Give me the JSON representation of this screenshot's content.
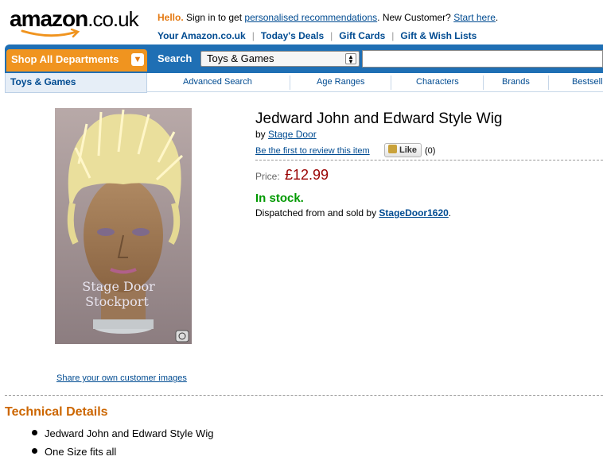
{
  "header": {
    "logo_text": "amazon",
    "logo_suffix": ".co.uk",
    "hello": "Hello.",
    "signin_text": " Sign in to get ",
    "personalised_link": "personalised recommendations",
    "new_customer": ". New Customer? ",
    "start_here": "Start here",
    "period": ".",
    "links": [
      "Your Amazon.co.uk",
      "Today's Deals",
      "Gift Cards",
      "Gift & Wish Lists"
    ]
  },
  "nav": {
    "shop_all": "Shop All Departments",
    "search_label": "Search",
    "search_category": "Toys & Games",
    "search_value": "",
    "store_name": "Toys & Games",
    "sub_items": [
      "Advanced Search",
      "Age Ranges",
      "Characters",
      "Brands",
      "Bestsell"
    ]
  },
  "product": {
    "image_watermark_line1": "Stage Door",
    "image_watermark_line2": "Stockport",
    "share_images": "Share your own customer images",
    "title": "Jedward John and Edward Style Wig",
    "by": "by ",
    "brand": "Stage Door",
    "review_link": "Be the first to review this item",
    "like_label": "Like",
    "like_count": "(0)",
    "price_label": "Price:",
    "price": "£12.99",
    "stock": "In stock.",
    "dispatch_prefix": "Dispatched from and sold by ",
    "seller": "StageDoor1620",
    "dispatch_suffix": "."
  },
  "technical": {
    "heading": "Technical Details",
    "bullets": [
      "Jedward John and Edward Style Wig",
      "One Size fits all"
    ]
  },
  "colors": {
    "nav_blue": "#1f6fb4",
    "orange": "#f0941f",
    "price_red": "#990000",
    "stock_green": "#009900",
    "heading_orange": "#cc6600"
  }
}
